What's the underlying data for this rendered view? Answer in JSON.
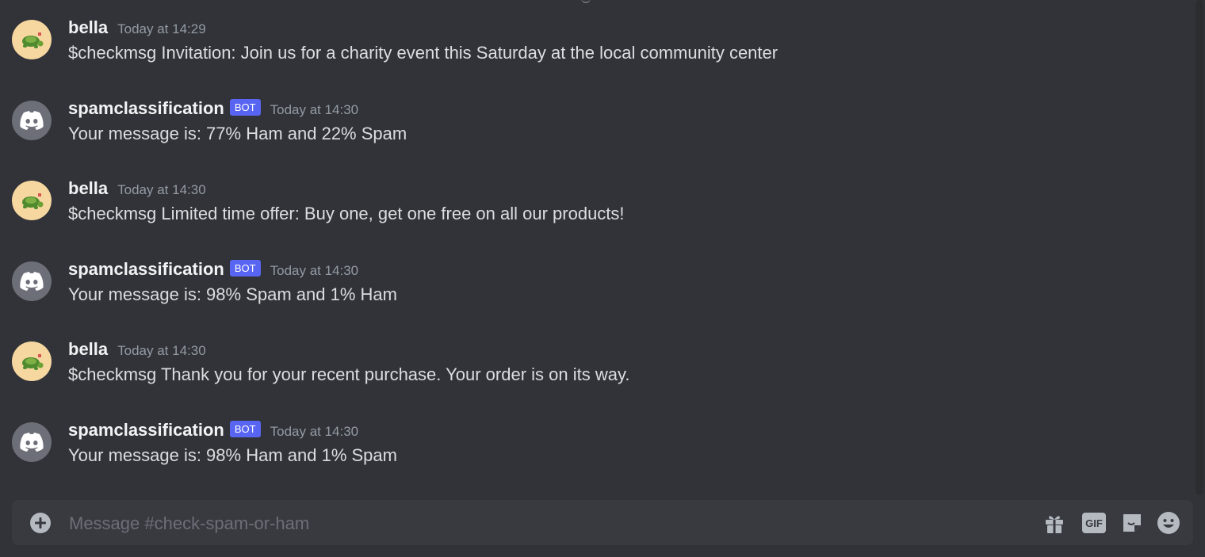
{
  "channel": {
    "name": "check-spam-or-ham"
  },
  "messages": [
    {
      "author": "bella",
      "is_bot": false,
      "time": "Today at 14:29",
      "text": "$checkmsg Invitation: Join us for a charity event this Saturday at the local community center"
    },
    {
      "author": "spamclassification",
      "is_bot": true,
      "badge": "BOT",
      "time": "Today at 14:30",
      "text": "Your message is: 77% Ham and 22% Spam"
    },
    {
      "author": "bella",
      "is_bot": false,
      "time": "Today at 14:30",
      "text": "$checkmsg Limited time offer: Buy one, get one free on all our products!"
    },
    {
      "author": "spamclassification",
      "is_bot": true,
      "badge": "BOT",
      "time": "Today at 14:30",
      "text": "Your message is: 98% Spam and 1% Ham"
    },
    {
      "author": "bella",
      "is_bot": false,
      "time": "Today at 14:30",
      "text": "$checkmsg Thank you for your recent purchase. Your order is on its way."
    },
    {
      "author": "spamclassification",
      "is_bot": true,
      "badge": "BOT",
      "time": "Today at 14:30",
      "text": "Your message is: 98% Ham and 1% Spam"
    }
  ],
  "composer": {
    "placeholder": "Message #check-spam-or-ham",
    "icons": [
      "plus-circle-icon",
      "gift-icon",
      "gif-icon",
      "sticker-icon",
      "emoji-icon"
    ]
  },
  "colors": {
    "background": "#313338",
    "bot_badge": "#5865f2",
    "composer": "#383a40"
  }
}
